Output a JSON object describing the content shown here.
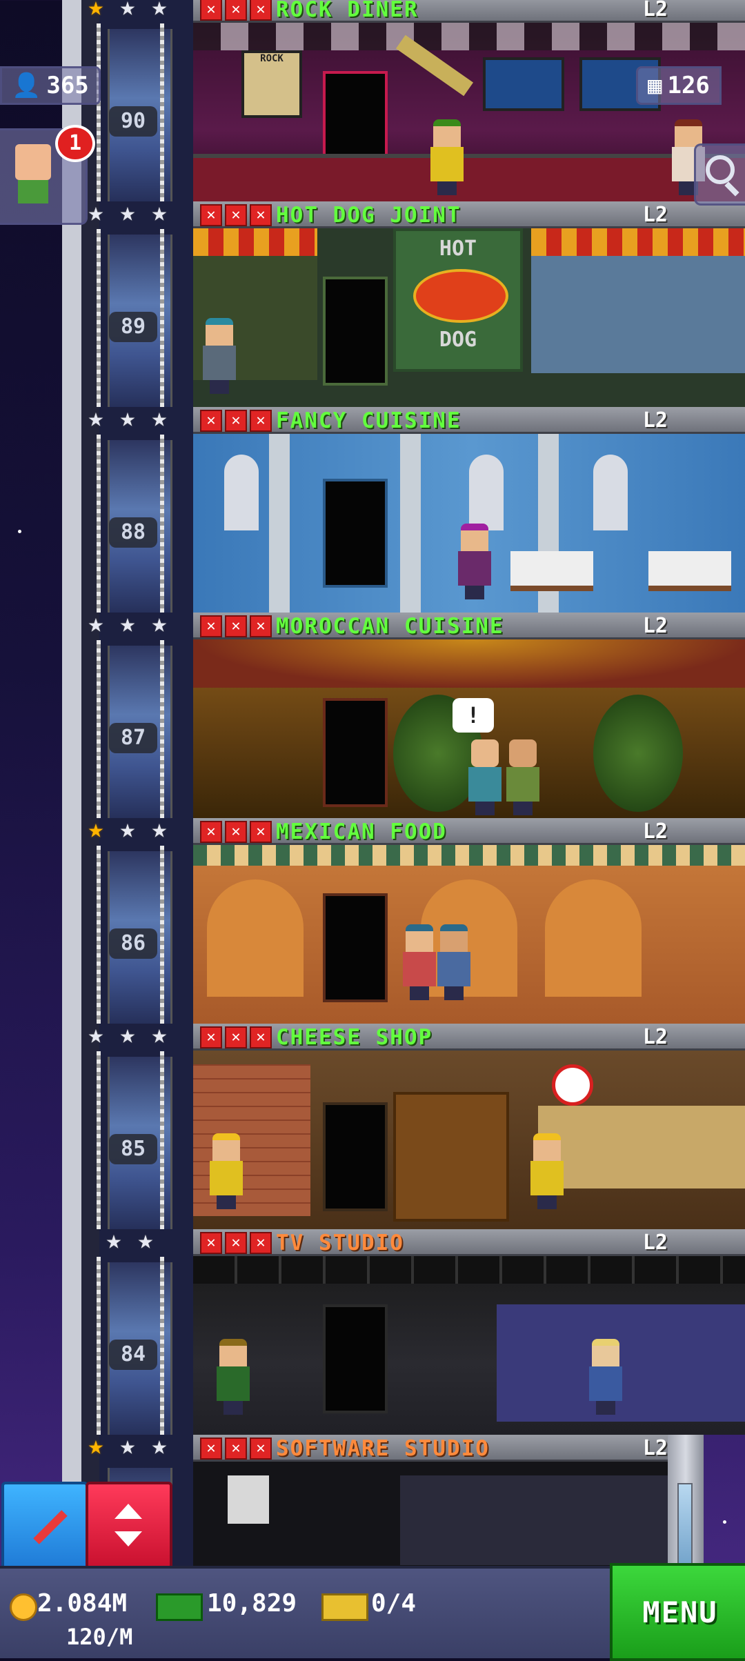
{
  "hud": {
    "population": "365",
    "floors_count": "126",
    "visitor_badge": "1"
  },
  "floors": [
    {
      "name": "ROCK DINER",
      "level": "L2",
      "number": "90",
      "stars_gold": 1,
      "name_color": "green"
    },
    {
      "name": "HOT DOG JOINT",
      "level": "L2",
      "number": "89",
      "stars_gold": 0,
      "name_color": "green"
    },
    {
      "name": "FANCY CUISINE",
      "level": "L2",
      "number": "88",
      "stars_gold": 0,
      "name_color": "green"
    },
    {
      "name": "MOROCCAN CUISINE",
      "level": "L2",
      "number": "87",
      "stars_gold": 0,
      "name_color": "green"
    },
    {
      "name": "MEXICAN FOOD",
      "level": "L2",
      "number": "86",
      "stars_gold": 1,
      "name_color": "green"
    },
    {
      "name": "CHEESE SHOP",
      "level": "L2",
      "number": "85",
      "stars_gold": 0,
      "name_color": "green"
    },
    {
      "name": "TV STUDIO",
      "level": "L2",
      "number": "84",
      "stars_gold": 0,
      "name_color": "orange"
    },
    {
      "name": "SOFTWARE STUDIO",
      "level": "L2",
      "number": "",
      "stars_gold": 1,
      "name_color": "orange"
    }
  ],
  "room_signs": {
    "hot_dog_top": "HOT",
    "hot_dog_bottom": "DOG",
    "rock_sign": "ROCK",
    "speech_bubble": "!"
  },
  "bottom": {
    "coins": "2.084M",
    "coins_rate": "120/M",
    "bux": "10,829",
    "tickets": "0/4",
    "menu_label": "MENU"
  },
  "colors": {
    "name_green": "#63ff3e",
    "name_orange": "#ff8a3c",
    "menu_green": "#2ab82a",
    "x_red": "#e02424",
    "star_gold": "#ffb400"
  }
}
